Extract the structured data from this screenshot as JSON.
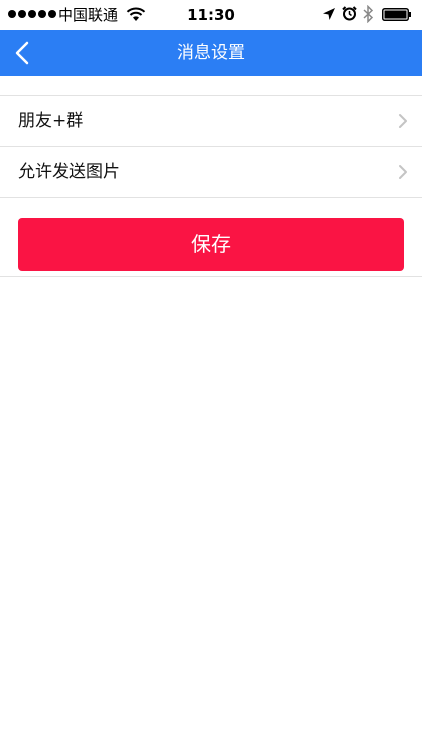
{
  "status_bar": {
    "carrier": "中国联通",
    "time": "11:30",
    "signal_bars": 5,
    "icons": [
      "wifi-icon",
      "location-icon",
      "alarm-icon",
      "bluetooth-icon",
      "battery-icon"
    ]
  },
  "nav": {
    "title": "消息设置",
    "back_icon": "chevron-left-icon",
    "color": "#2b7ef4"
  },
  "settings": {
    "items": [
      {
        "label": "朋友+群"
      },
      {
        "label": "允许发送图片"
      }
    ]
  },
  "actions": {
    "save_label": "保存",
    "save_color": "#fa1444"
  }
}
